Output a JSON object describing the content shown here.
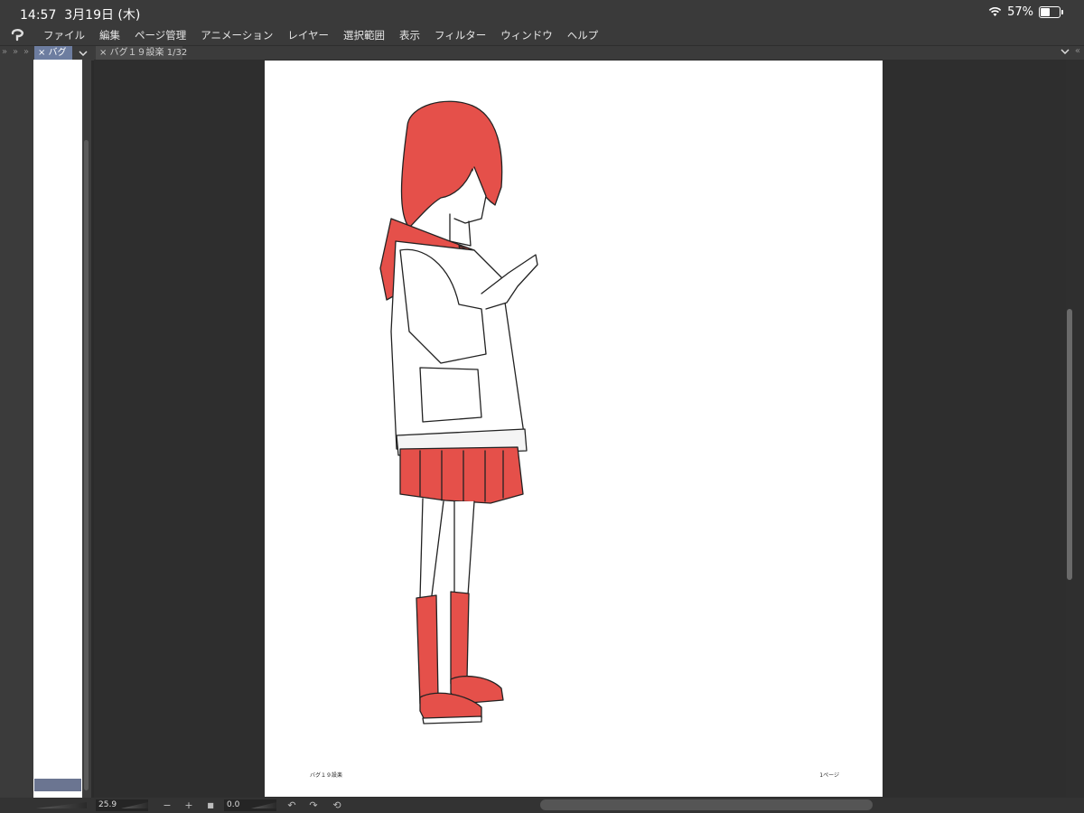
{
  "status": {
    "time": "14:57",
    "date": "3月19日 (木)",
    "battery": "57%",
    "battery_level": 0.57
  },
  "menu": [
    "ファイル",
    "編集",
    "ページ管理",
    "アニメーション",
    "レイヤー",
    "選択範囲",
    "表示",
    "フィルター",
    "ウィンドウ",
    "ヘルプ"
  ],
  "left_tab": {
    "label": "× バグ"
  },
  "document_tab": {
    "label": "× バグ１９設楽 1/32"
  },
  "page": {
    "footer_left": "バグ１９設楽",
    "footer_right": "1ページ"
  },
  "toolbar": {
    "zoom": "25.9",
    "zoom_out": "−",
    "zoom_in": "+",
    "fit": "■",
    "angle": "0.0",
    "undo": "↶",
    "redo": "↷",
    "reset": "⟲"
  },
  "colors": {
    "accent_red": "#e5504a",
    "tab_active": "#6d7da0",
    "background": "#2b2b2b"
  }
}
